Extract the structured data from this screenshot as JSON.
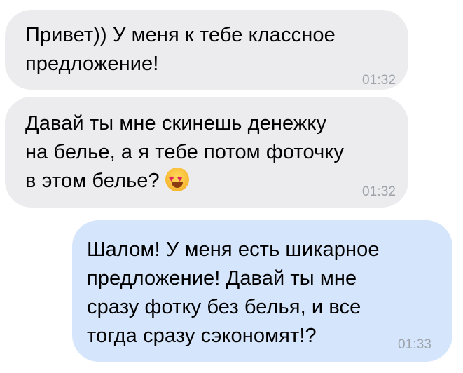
{
  "messages": [
    {
      "direction": "incoming",
      "text": "Привет)) У меня к тебе классное\nпредложение!",
      "time": "01:32"
    },
    {
      "direction": "incoming",
      "text": "Давай ты мне скинешь денежку\nна белье, а я тебе потом фоточку\nв этом белье?",
      "emoji": "heart-eyes-emoji-icon",
      "time": "01:32"
    },
    {
      "direction": "outgoing",
      "text": "Шалом! У меня есть шикарное\nпредложение! Давай ты мне\nсразу фотку без белья, и все\nтогда сразу сэкономят!?",
      "time": "01:33"
    }
  ],
  "colors": {
    "incoming_bubble": "#ececee",
    "outgoing_bubble": "#d5e5fb",
    "timestamp": "#9da3ab",
    "text": "#000000"
  }
}
